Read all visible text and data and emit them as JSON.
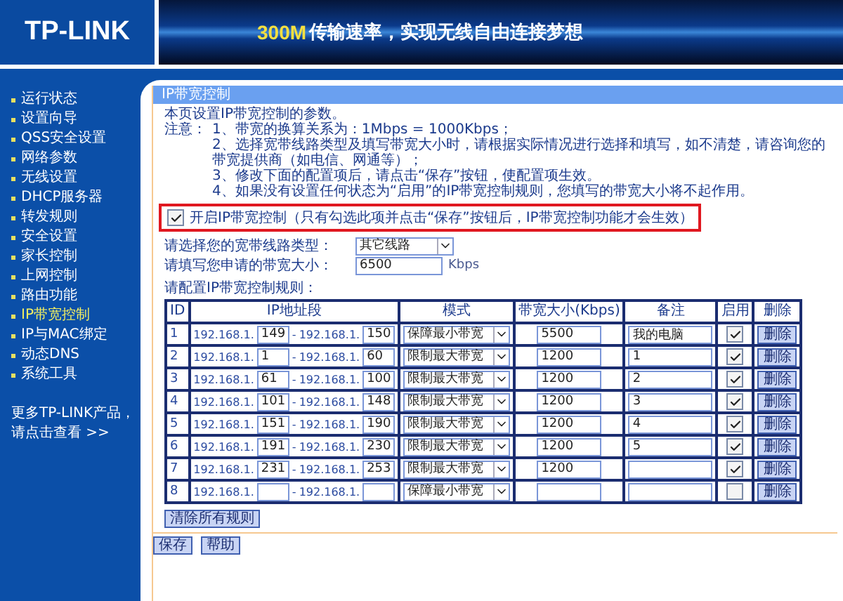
{
  "header": {
    "logo": "TP-LINK",
    "slogan_highlight": "300M",
    "slogan": "传输速率，实现无线自由连接梦想"
  },
  "sidebar": {
    "items": [
      {
        "label": "运行状态",
        "selected": false
      },
      {
        "label": "设置向导",
        "selected": false
      },
      {
        "label": "QSS安全设置",
        "selected": false
      },
      {
        "label": "网络参数",
        "selected": false
      },
      {
        "label": "无线设置",
        "selected": false
      },
      {
        "label": "DHCP服务器",
        "selected": false
      },
      {
        "label": "转发规则",
        "selected": false
      },
      {
        "label": "安全设置",
        "selected": false
      },
      {
        "label": "家长控制",
        "selected": false
      },
      {
        "label": "上网控制",
        "selected": false
      },
      {
        "label": "路由功能",
        "selected": false
      },
      {
        "label": "IP带宽控制",
        "selected": true
      },
      {
        "label": "IP与MAC绑定",
        "selected": false
      },
      {
        "label": "动态DNS",
        "selected": false
      },
      {
        "label": "系统工具",
        "selected": false
      }
    ],
    "footer": [
      "更多TP-LINK产品，",
      "请点击查看 >>"
    ]
  },
  "panel": {
    "title": "IP带宽控制",
    "intro": "本页设置IP带宽控制的参数。",
    "notes_label": "注意：",
    "range_separator": "-",
    "notes": [
      "1、带宽的换算关系为：1Mbps = 1000Kbps；",
      "2、选择宽带线路类型及填写带宽大小时，请根据实际情况进行选择和填写，如不清楚，请咨询您的带宽提供商（如电信、网通等）；",
      "3、修改下面的配置项后，请点击“保存”按钮，使配置项生效。",
      "4、如果没有设置任何状态为“启用”的IP带宽控制规则，您填写的带宽大小将不起作用。"
    ],
    "enable": {
      "label": "开启IP带宽控制（只有勾选此项并点击“保存”按钮后，IP带宽控制功能才会生效）",
      "checked": true,
      "highlighted": true
    },
    "line_type": {
      "label": "请选择您的宽带线路类型：",
      "value": "其它线路"
    },
    "bandwidth": {
      "label": "请填写您申请的带宽大小：",
      "value": "6500",
      "unit": "Kbps"
    },
    "rules_label": "请配置IP带宽控制规则：",
    "table": {
      "columns": [
        "ID",
        "IP地址段",
        "模式",
        "带宽大小(Kbps)",
        "备注",
        "启用",
        "删除"
      ],
      "rows": [
        {
          "id": "1",
          "prefix_start": "192.168.1.",
          "start": "149",
          "prefix_end": "192.168.1.",
          "end": "150",
          "mode": "保障最小带宽",
          "bandwidth": "5500",
          "remark": "我的电脑",
          "enabled": true,
          "delete": "删除"
        },
        {
          "id": "2",
          "prefix_start": "192.168.1.",
          "start": "1",
          "prefix_end": "192.168.1.",
          "end": "60",
          "mode": "限制最大带宽",
          "bandwidth": "1200",
          "remark": "1",
          "enabled": true,
          "delete": "删除"
        },
        {
          "id": "3",
          "prefix_start": "192.168.1.",
          "start": "61",
          "prefix_end": "192.168.1.",
          "end": "100",
          "mode": "限制最大带宽",
          "bandwidth": "1200",
          "remark": "2",
          "enabled": true,
          "delete": "删除"
        },
        {
          "id": "4",
          "prefix_start": "192.168.1.",
          "start": "101",
          "prefix_end": "192.168.1.",
          "end": "148",
          "mode": "限制最大带宽",
          "bandwidth": "1200",
          "remark": "3",
          "enabled": true,
          "delete": "删除"
        },
        {
          "id": "5",
          "prefix_start": "192.168.1.",
          "start": "151",
          "prefix_end": "192.168.1.",
          "end": "190",
          "mode": "限制最大带宽",
          "bandwidth": "1200",
          "remark": "4",
          "enabled": true,
          "delete": "删除"
        },
        {
          "id": "6",
          "prefix_start": "192.168.1.",
          "start": "191",
          "prefix_end": "192.168.1.",
          "end": "230",
          "mode": "限制最大带宽",
          "bandwidth": "1200",
          "remark": "5",
          "enabled": true,
          "delete": "删除"
        },
        {
          "id": "7",
          "prefix_start": "192.168.1.",
          "start": "231",
          "prefix_end": "192.168.1.",
          "end": "253",
          "mode": "限制最大带宽",
          "bandwidth": "1200",
          "enabled": true,
          "delete": "删除"
        },
        {
          "id": "8",
          "prefix_start": "192.168.1.",
          "prefix_end": "192.168.1.",
          "mode": "保障最小带宽",
          "enabled": false,
          "delete": "删除"
        }
      ]
    },
    "clear_button": "清除所有规则",
    "buttons": [
      "保存",
      "帮助"
    ]
  }
}
